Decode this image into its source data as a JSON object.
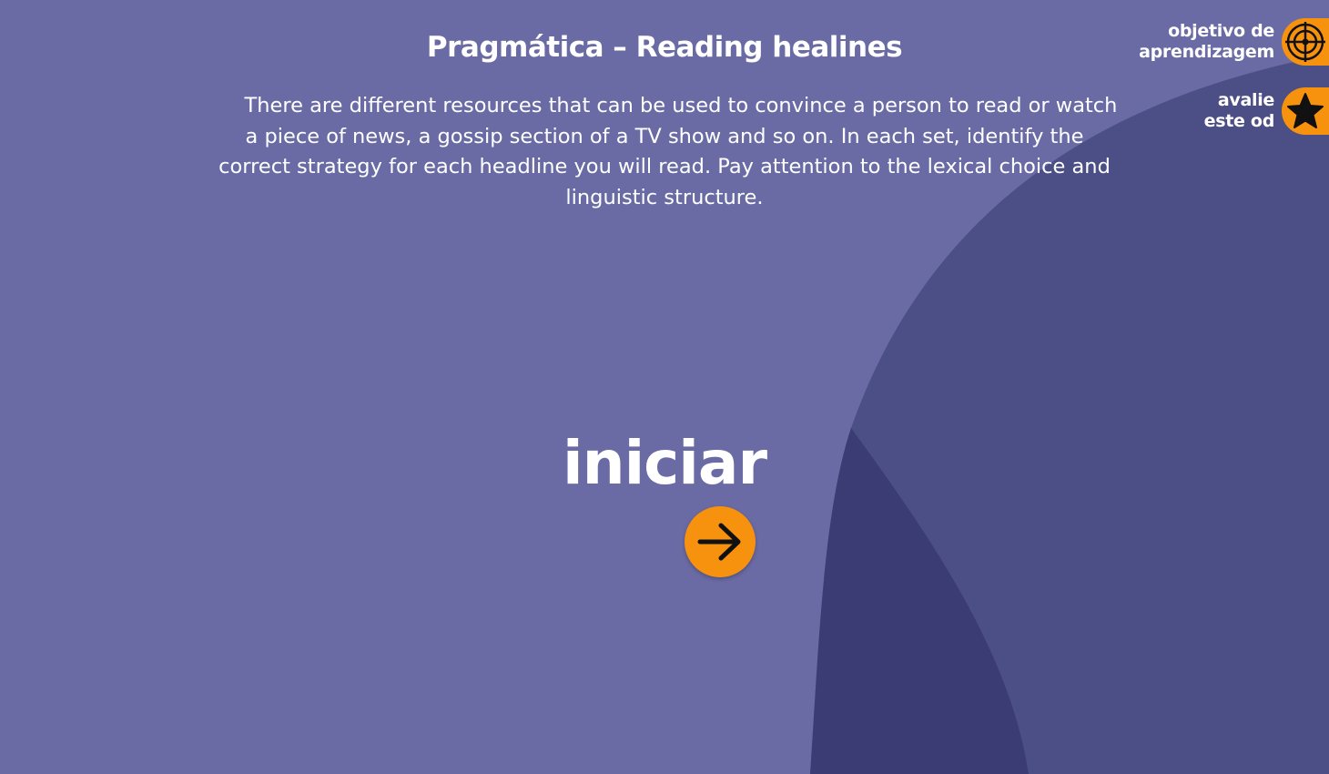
{
  "header": {
    "title": "Pragmática – Reading healines"
  },
  "intro": {
    "text": "There are different resources that can be used to convince a person to read or watch a piece of news, a gossip section of a TV show and so on. In each set, identify the correct strategy for each headline you will read. Pay attention to the lexical choice and linguistic structure."
  },
  "start": {
    "label": "iniciar",
    "icon": "arrow-right-icon"
  },
  "corner_menu": {
    "objective": {
      "line1": "objetivo de",
      "line2": "aprendizagem",
      "icon": "target-icon"
    },
    "rating": {
      "line1": "avalie",
      "line2": "este od",
      "icon": "star-icon"
    }
  },
  "colors": {
    "background": "#6a6ba4",
    "wave_mid": "#4c4e86",
    "wave_dark": "#3c3c74",
    "accent_orange": "#f7920f",
    "text": "#ffffff"
  }
}
